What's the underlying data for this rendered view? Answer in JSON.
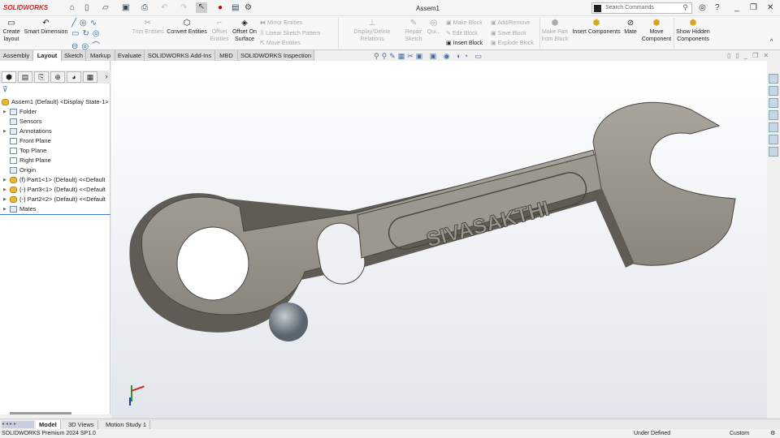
{
  "app": {
    "logo": "SOLIDWORKS",
    "title": "Assem1",
    "search_placeholder": "Search Commands"
  },
  "ribbon": {
    "create_layout": "Create layout",
    "smart_dimension": "Smart Dimension",
    "trim_entities": "Trim Entities",
    "convert_entities": "Convert Entities",
    "offset_entities": "Offset Entities",
    "offset_on_surface": "Offset On Surface",
    "mirror_entities": "Mirror Entities",
    "linear_sketch_pattern": "Linear Sketch Pattern",
    "move_entities": "Move Entities",
    "display_delete_relations": "Display/Delete Relations",
    "repair_sketch": "Repair Sketch",
    "quick_snaps": "Qui...",
    "make_block": "Make Block",
    "edit_block": "Edit Block",
    "insert_block": "Insert Block",
    "add_remove": "Add/Remove",
    "save_block": "Save Block",
    "explode_block": "Explode Block",
    "make_part_from_block": "Make Part from Block",
    "insert_components": "Insert Components",
    "mate": "Mate",
    "move_component": "Move Component",
    "show_hidden_components": "Show Hidden Components"
  },
  "tabs": [
    "Assembly",
    "Layout",
    "Sketch",
    "Markup",
    "Evaluate",
    "SOLIDWORKS Add-Ins",
    "MBD",
    "SOLIDWORKS Inspection"
  ],
  "tree": [
    {
      "label": "Assem1 (Default) <Display State-1>",
      "icon": "assembly"
    },
    {
      "label": "Folder",
      "icon": "folder",
      "arrow": true
    },
    {
      "label": "Sensors",
      "icon": "sensor"
    },
    {
      "label": "Annotations",
      "icon": "annotation",
      "arrow": true
    },
    {
      "label": "Front Plane",
      "icon": "plane"
    },
    {
      "label": "Top Plane",
      "icon": "plane"
    },
    {
      "label": "Right Plane",
      "icon": "plane"
    },
    {
      "label": "Origin",
      "icon": "origin"
    },
    {
      "label": "(f) Part1<1> (Default) <<Default",
      "icon": "part",
      "arrow": true
    },
    {
      "label": "(-) Part3<1> (Default) <<Default",
      "icon": "part",
      "arrow": true
    },
    {
      "label": "(-) Part2<2> (Default) <<Default",
      "icon": "part",
      "arrow": true
    },
    {
      "label": "Mates",
      "icon": "mates",
      "arrow": true
    }
  ],
  "model": {
    "engraving": "SIVASAKTHI"
  },
  "bottom_tabs": [
    "Model",
    "3D Views",
    "Motion Study 1"
  ],
  "status": {
    "version": "SOLIDWORKS Premium 2024 SP1.0",
    "state": "Under Defined",
    "units": "Custom"
  }
}
